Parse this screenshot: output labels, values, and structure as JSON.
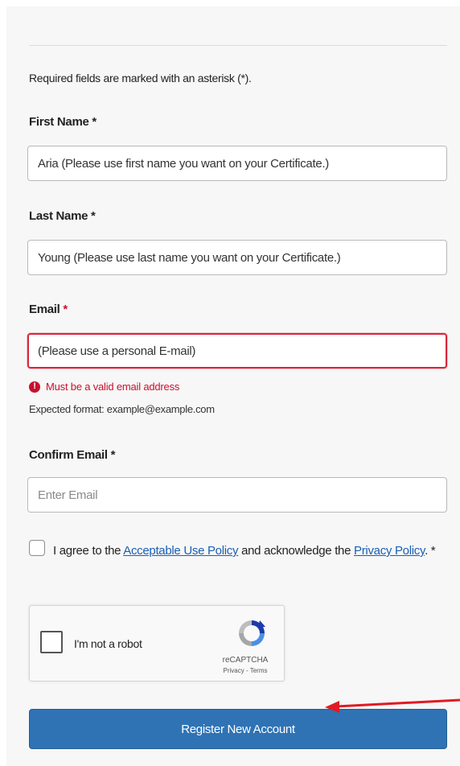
{
  "form": {
    "required_note": "Required fields are marked with an asterisk (*).",
    "asterisk": "*",
    "first_name": {
      "label": "First Name",
      "value": "Aria (Please use first name you want on your Certificate.)"
    },
    "last_name": {
      "label": "Last Name",
      "value": "Young (Please use last name you want on your Certificate.)"
    },
    "email": {
      "label": "Email",
      "value": "(Please use a personal E-mail)",
      "error": "Must be a valid email address",
      "hint": "Expected format: example@example.com"
    },
    "confirm_email": {
      "label": "Confirm Email",
      "placeholder": "Enter Email"
    },
    "agreement": {
      "text_before": "I agree to the ",
      "link_aup": "Acceptable Use Policy",
      "text_middle": " and acknowledge the ",
      "link_privacy": "Privacy Policy",
      "text_after": ". *"
    },
    "captcha": {
      "label": "I'm not a robot",
      "brand": "reCAPTCHA",
      "links": "Privacy - Terms"
    },
    "submit_label": "Register New Account"
  },
  "colors": {
    "error": "#c8102e",
    "button": "#2f73b5",
    "link": "#1a5fb4",
    "annotation_arrow": "#e01b24"
  },
  "icons": {
    "error_icon": "exclamation-circle",
    "captcha_logo": "recaptcha-logo",
    "annotation": "arrow-left"
  }
}
